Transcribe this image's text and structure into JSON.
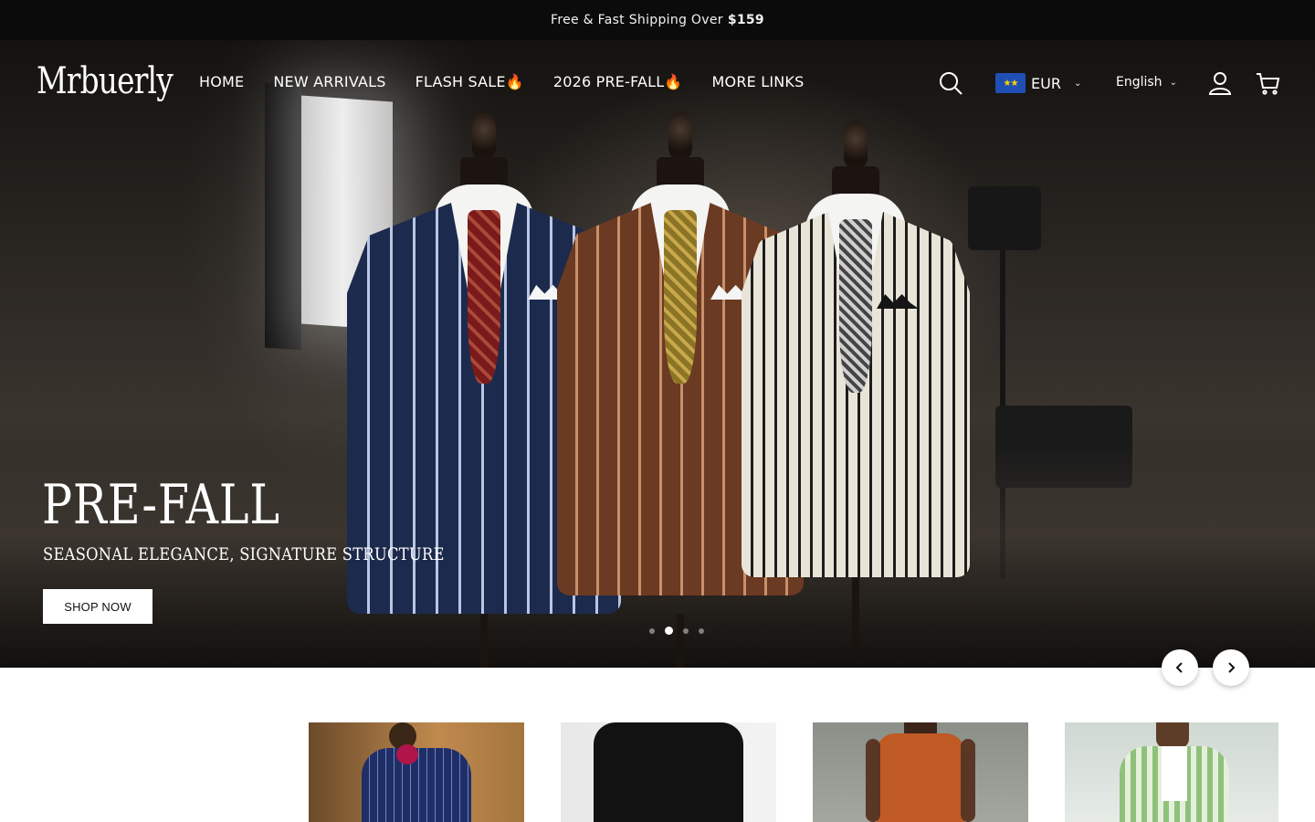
{
  "announcement": {
    "text": "Free & Fast Shipping Over",
    "highlight": "$159"
  },
  "header": {
    "logo": "Mrbuerly",
    "nav": [
      {
        "label": "HOME"
      },
      {
        "label": "NEW ARRIVALS"
      },
      {
        "label": "FLASH SALE🔥"
      },
      {
        "label": "2026 PRE-FALL🔥"
      },
      {
        "label": "MORE LINKS"
      }
    ],
    "currency": {
      "code": "EUR",
      "flag": "eu-flag-icon"
    },
    "language": "English",
    "icons": [
      "search-icon",
      "account-icon",
      "cart-icon"
    ]
  },
  "hero": {
    "title": "PRE-FALL",
    "subtitle": "SEASONAL ELEGANCE, SIGNATURE STRUCTURE",
    "cta_label": "SHOP NOW",
    "slides_total": 4,
    "active_slide": 2
  },
  "colors": {
    "announcement_bg": "#0b0b0b",
    "button_bg": "#ffffff",
    "text_light": "#ffffff"
  }
}
